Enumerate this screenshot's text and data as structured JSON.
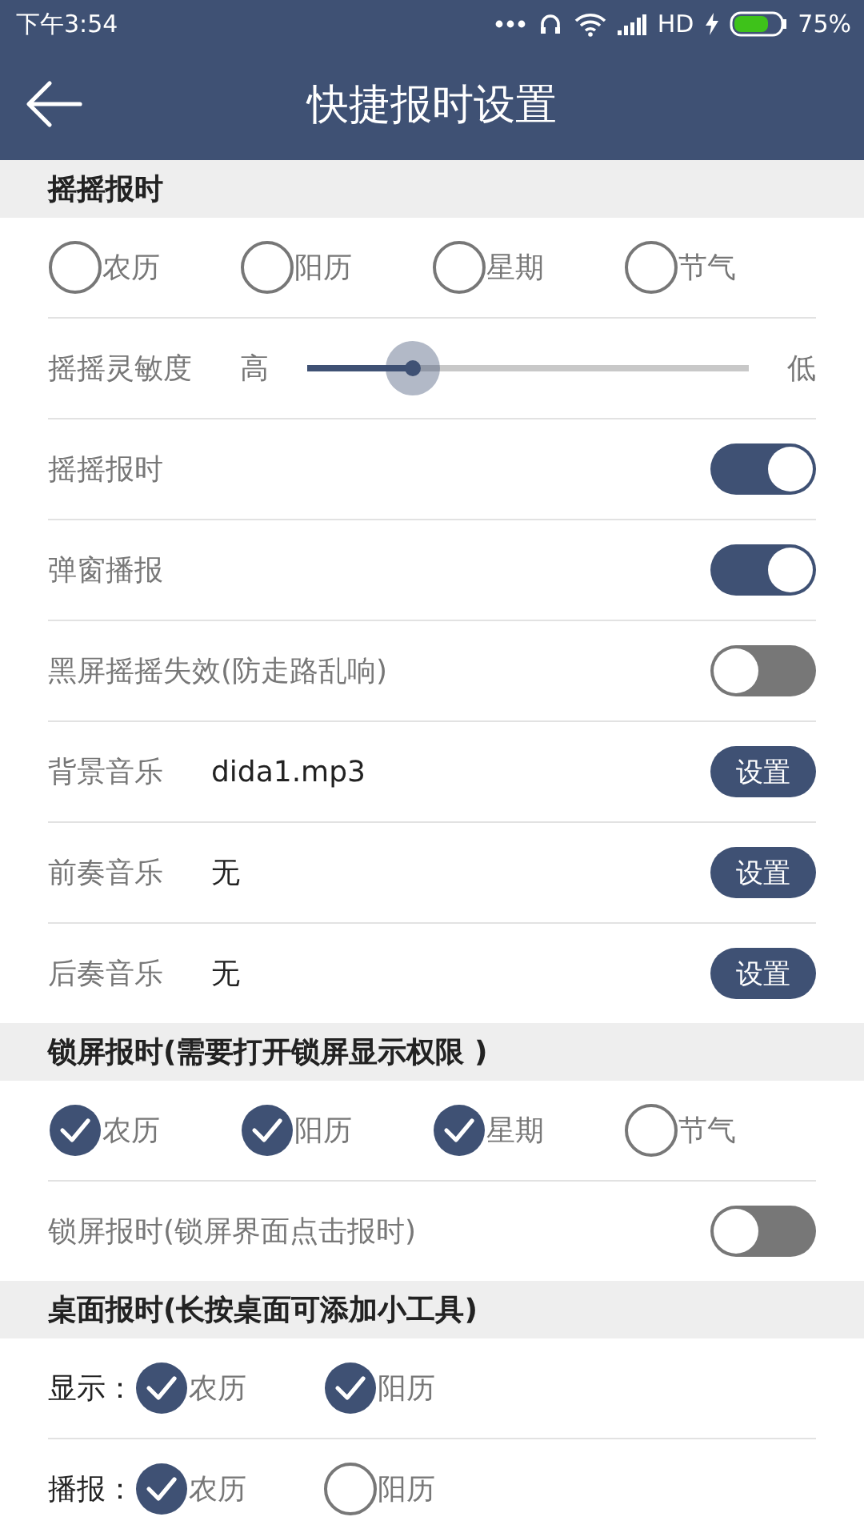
{
  "status_bar": {
    "time": "下午3:54",
    "network": "HD",
    "battery": "75%"
  },
  "header": {
    "title": "快捷报时设置"
  },
  "sections": [
    {
      "title": "摇摇报时",
      "rows": [
        {
          "kind": "options",
          "options": [
            {
              "label": "农历",
              "checked": false
            },
            {
              "label": "阳历",
              "checked": false
            },
            {
              "label": "星期",
              "checked": false
            },
            {
              "label": "节气",
              "checked": false
            }
          ]
        },
        {
          "kind": "slider",
          "label": "摇摇灵敏度",
          "high": "高",
          "low": "低",
          "level": 0.24
        },
        {
          "kind": "toggle",
          "label": "摇摇报时",
          "on": true
        },
        {
          "kind": "toggle",
          "label": "弹窗播报",
          "on": true
        },
        {
          "kind": "toggle",
          "label": "黑屏摇摇失效(防走路乱响)",
          "on": false
        },
        {
          "kind": "file",
          "label": "背景音乐",
          "value": "dida1.mp3",
          "button": "设置"
        },
        {
          "kind": "file",
          "label": "前奏音乐",
          "value": "无",
          "button": "设置"
        },
        {
          "kind": "file",
          "label": "后奏音乐",
          "value": "无",
          "button": "设置"
        }
      ]
    },
    {
      "title": "锁屏报时(需要打开锁屏显示权限 )",
      "rows": [
        {
          "kind": "options",
          "options": [
            {
              "label": "农历",
              "checked": true
            },
            {
              "label": "阳历",
              "checked": true
            },
            {
              "label": "星期",
              "checked": true
            },
            {
              "label": "节气",
              "checked": false
            }
          ]
        },
        {
          "kind": "toggle",
          "label": "锁屏报时(锁屏界面点击报时)",
          "on": false
        }
      ]
    },
    {
      "title": "桌面报时(长按桌面可添加小工具)",
      "rows": [
        {
          "kind": "options",
          "prefix": "显示：",
          "options": [
            {
              "label": "农历",
              "checked": true
            },
            {
              "label": "阳历",
              "checked": true
            }
          ]
        },
        {
          "kind": "options",
          "prefix": "播报：",
          "options": [
            {
              "label": "农历",
              "checked": true
            },
            {
              "label": "阳历",
              "checked": false
            }
          ]
        }
      ]
    }
  ]
}
